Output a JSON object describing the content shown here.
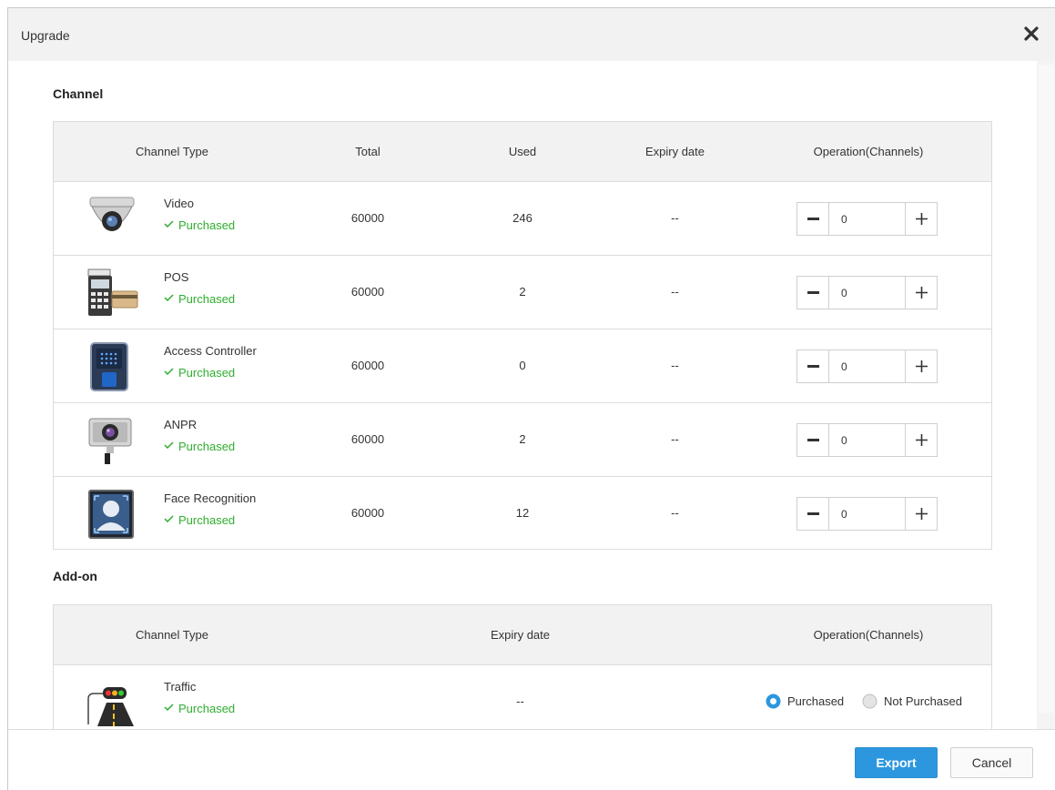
{
  "dialog": {
    "title": "Upgrade"
  },
  "channel_section": {
    "title": "Channel",
    "headers": {
      "type": "Channel Type",
      "total": "Total",
      "used": "Used",
      "expiry": "Expiry date",
      "operation": "Operation(Channels)"
    },
    "rows": [
      {
        "icon": "dome-camera-icon",
        "name": "Video",
        "status": "Purchased",
        "total": "60000",
        "used": "246",
        "expiry": "--",
        "count": "0"
      },
      {
        "icon": "pos-terminal-icon",
        "name": "POS",
        "status": "Purchased",
        "total": "60000",
        "used": "2",
        "expiry": "--",
        "count": "0"
      },
      {
        "icon": "access-controller-icon",
        "name": "Access Controller",
        "status": "Purchased",
        "total": "60000",
        "used": "0",
        "expiry": "--",
        "count": "0"
      },
      {
        "icon": "anpr-camera-icon",
        "name": "ANPR",
        "status": "Purchased",
        "total": "60000",
        "used": "2",
        "expiry": "--",
        "count": "0"
      },
      {
        "icon": "face-recognition-icon",
        "name": "Face Recognition",
        "status": "Purchased",
        "total": "60000",
        "used": "12",
        "expiry": "--",
        "count": "0"
      }
    ]
  },
  "addon_section": {
    "title": "Add-on",
    "headers": {
      "type": "Channel Type",
      "expiry": "Expiry date",
      "operation": "Operation(Channels)"
    },
    "rows": [
      {
        "icon": "traffic-light-icon",
        "name": "Traffic",
        "status": "Purchased",
        "expiry": "--",
        "option_purchased": "Purchased",
        "option_not_purchased": "Not Purchased",
        "selected": "Purchased"
      }
    ]
  },
  "footer": {
    "export_label": "Export",
    "cancel_label": "Cancel"
  },
  "colors": {
    "accent": "#2c97de",
    "status_green": "#2fae2f",
    "header_bg": "#f2f2f2"
  }
}
